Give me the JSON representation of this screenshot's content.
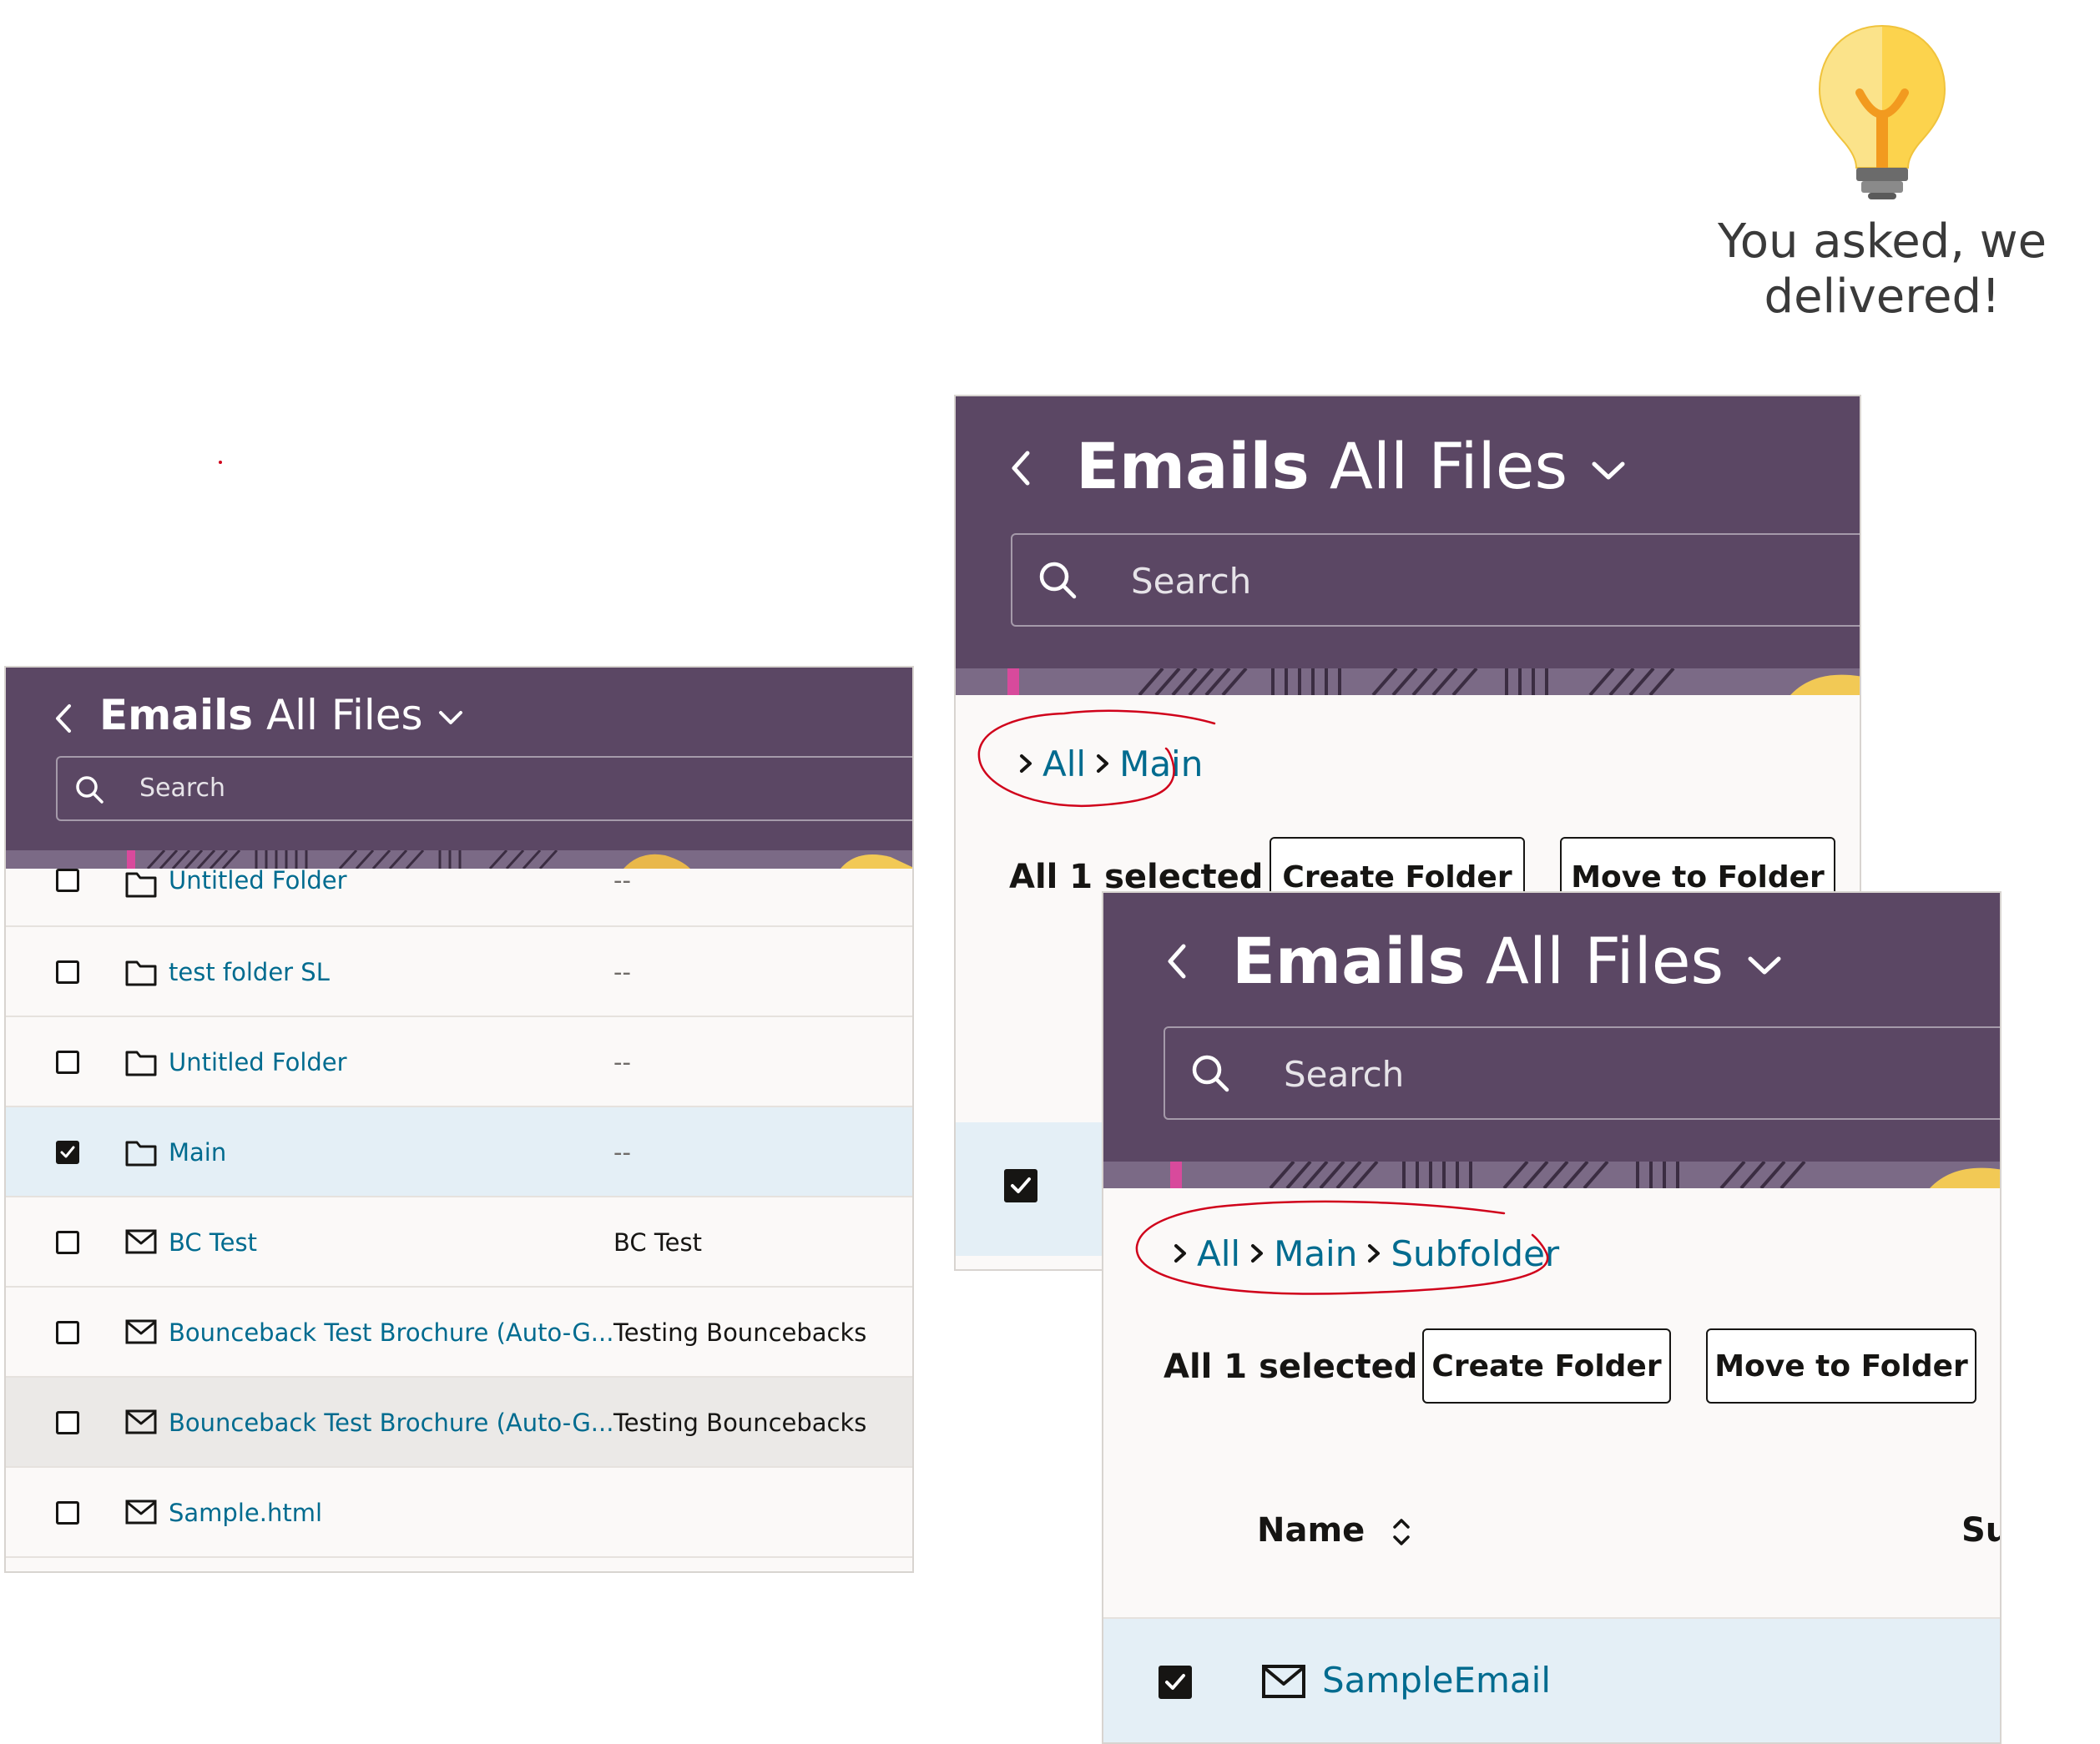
{
  "tip": {
    "text": "You asked, we\ndelivered!",
    "icon": "lightbulb-icon"
  },
  "colors": {
    "header": "#5b4764",
    "link": "#006b8f",
    "selected_row": "#e4eff6",
    "annotation": "#d0021b",
    "bulb_yellow": "#fcd34d",
    "bulb_orange": "#f29a1f"
  },
  "panel1": {
    "back_icon": "chevron-left-icon",
    "title_bold": "Emails",
    "title_rest": "All Files",
    "title_icon": "chevron-down-icon",
    "search_placeholder": "Search",
    "rows": [
      {
        "name": "Untitled Folder",
        "subject": "--",
        "icon": "folder-icon",
        "checked": false
      },
      {
        "name": "test folder SL",
        "subject": "--",
        "icon": "folder-icon",
        "checked": false
      },
      {
        "name": "Untitled Folder",
        "subject": "--",
        "icon": "folder-icon",
        "checked": false
      },
      {
        "name": "Main",
        "subject": "--",
        "icon": "folder-icon",
        "checked": true
      },
      {
        "name": "BC Test",
        "subject": "BC Test",
        "icon": "email-icon",
        "checked": false
      },
      {
        "name": "Bounceback Test Brochure (Auto-G...",
        "subject": "Testing Bouncebacks",
        "icon": "email-icon",
        "checked": false
      },
      {
        "name": "Bounceback Test Brochure (Auto-G...",
        "subject": "Testing Bouncebacks",
        "icon": "email-icon",
        "checked": false
      },
      {
        "name": "Sample.html",
        "subject": "",
        "icon": "email-icon",
        "checked": false
      }
    ]
  },
  "panel2": {
    "back_icon": "chevron-left-icon",
    "title_bold": "Emails",
    "title_rest": "All Files",
    "title_icon": "chevron-down-icon",
    "search_placeholder": "Search",
    "breadcrumbs": [
      "All",
      "Main"
    ],
    "selected_text": "All 1 selected",
    "create_folder": "Create Folder",
    "move_to_folder": "Move to Folder"
  },
  "panel3": {
    "back_icon": "chevron-left-icon",
    "title_bold": "Emails",
    "title_rest": "All Files",
    "title_icon": "chevron-down-icon",
    "search_placeholder": "Search",
    "breadcrumbs": [
      "All",
      "Main",
      "Subfolder"
    ],
    "selected_text": "All 1 selected",
    "create_folder": "Create Folder",
    "move_to_folder": "Move to Folder",
    "col_name": "Name",
    "col_sort_icon": "sort-icon",
    "col_subject": "Su",
    "row_name": "SampleEmail",
    "row_icon": "email-icon"
  }
}
